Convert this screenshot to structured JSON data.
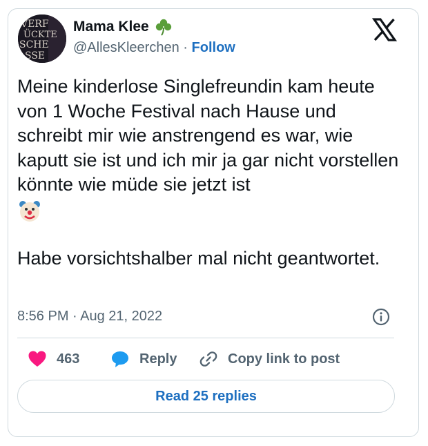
{
  "author": {
    "display_name": "Mama Klee",
    "handle": "@AllesKleerchen",
    "separator": "·",
    "follow_label": "Follow",
    "name_emoji": "shamrock-icon",
    "avatar_text": [
      "VERF",
      "ÜCKTE",
      "SCHE",
      "SSE"
    ]
  },
  "tweet": {
    "paragraph1": "Meine kinderlose Singlefreundin kam heute von 1 Woche Festival nach Hause und schreibt mir wie anstrengend es war, wie kaputt sie ist und ich mir ja gar nicht vorstellen könnte wie müde sie jetzt ist",
    "emoji": "clown-face-icon",
    "paragraph2": "Habe vorsichtshalber mal nicht geantwortet.",
    "timestamp": "8:56 PM · Aug 21, 2022"
  },
  "actions": {
    "like_count": "463",
    "reply_label": "Reply",
    "copy_label": "Copy link to post"
  },
  "footer": {
    "read_replies_label": "Read 25 replies"
  },
  "colors": {
    "accent_link": "#1d6fc0",
    "like_heart": "#f91880",
    "reply_bubble": "#1d9bf0",
    "text_primary": "#0f1419",
    "text_secondary": "#536471",
    "border": "#cfd9de"
  }
}
